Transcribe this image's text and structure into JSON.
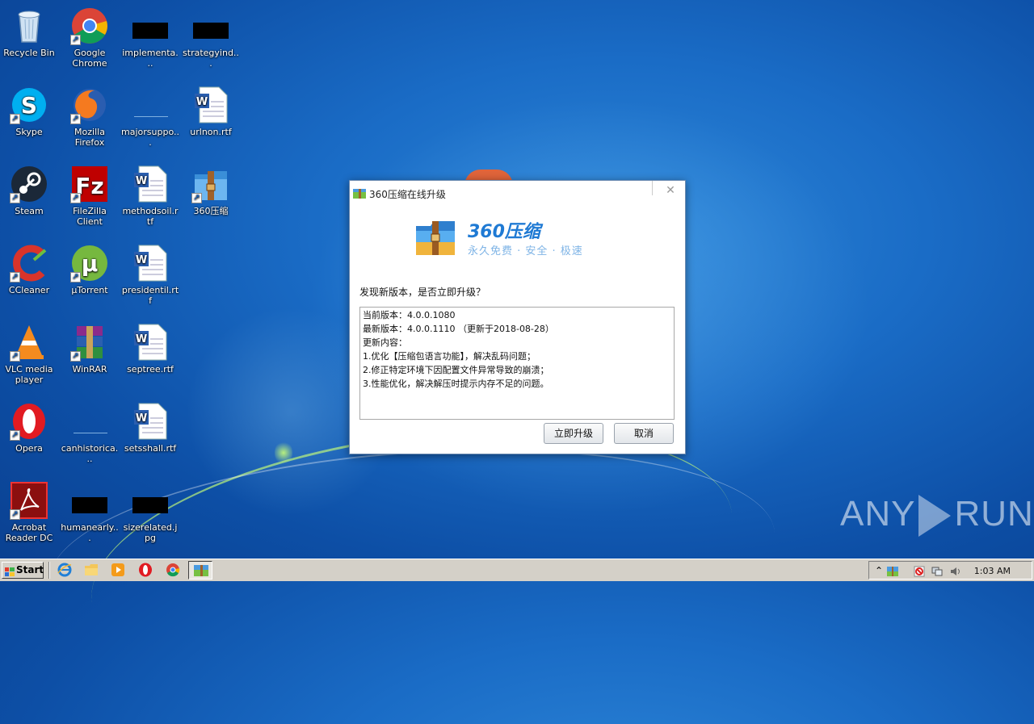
{
  "desktop": {
    "icons": [
      {
        "label": "Recycle Bin"
      },
      {
        "label": "Google Chrome"
      },
      {
        "label": "implementa..."
      },
      {
        "label": "strategyind..."
      },
      {
        "label": "Skype"
      },
      {
        "label": "Mozilla Firefox"
      },
      {
        "label": "majorsuppo..."
      },
      {
        "label": "urlnon.rtf"
      },
      {
        "label": "Steam"
      },
      {
        "label": "FileZilla Client"
      },
      {
        "label": "methodsoil.rtf"
      },
      {
        "label": "360压缩"
      },
      {
        "label": "CCleaner"
      },
      {
        "label": "µTorrent"
      },
      {
        "label": "presidentil.rtf"
      },
      {
        "label": "VLC media player"
      },
      {
        "label": "WinRAR"
      },
      {
        "label": "septree.rtf"
      },
      {
        "label": "Opera"
      },
      {
        "label": "canhistorica..."
      },
      {
        "label": "setsshall.rtf"
      },
      {
        "label": "Acrobat Reader DC"
      },
      {
        "label": "humanearly..."
      },
      {
        "label": "sizerelated.jpg"
      }
    ]
  },
  "dialog": {
    "title": "360压缩在线升级",
    "close_glyph": "✕",
    "brand_name": "360压缩",
    "brand_slogan": "永久免费 · 安全 · 极速",
    "question": "发现新版本，是否立即升级？",
    "details": [
      "当前版本：4.0.0.1080",
      "最新版本：4.0.0.1110 （更新于2018-08-28）",
      "更新内容：",
      "1.优化【压缩包语言功能】，解决乱码问题；",
      "2.修正特定环境下因配置文件异常导致的崩溃；",
      "3.性能优化，解决解压时提示内存不足的问题。"
    ],
    "upgrade_button": "立即升级",
    "cancel_button": "取消"
  },
  "watermark": {
    "left": "ANY",
    "right": "RUN"
  },
  "taskbar": {
    "start_label": "Start",
    "quick_launch": [
      "ie-icon",
      "explorer-icon",
      "media-player-icon",
      "opera-icon",
      "chrome-icon",
      "360zip-icon"
    ],
    "tray_icons": [
      "chevron-up-icon",
      "360zip-tray-icon",
      "antivirus-icon",
      "network-icon",
      "volume-icon"
    ],
    "clock": "1:03 AM"
  },
  "colors": {
    "desktop_blue": "#1a6cc6",
    "brand_blue": "#1f7ad4",
    "taskbar": "#d4d0c8"
  }
}
